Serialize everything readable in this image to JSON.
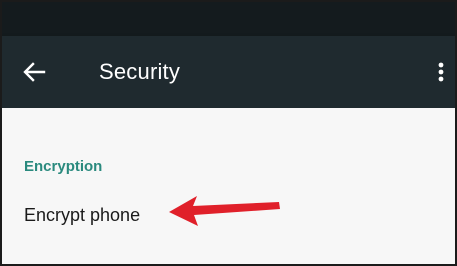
{
  "toolbar": {
    "title": "Security",
    "back_icon": "arrow-back-icon",
    "overflow_icon": "more-vert-icon"
  },
  "sections": [
    {
      "header": "Encryption",
      "items": [
        {
          "label": "Encrypt phone"
        }
      ]
    }
  ],
  "colors": {
    "status_bar": "#141b1e",
    "toolbar": "#1f2a2f",
    "section_header": "#2a8a7e",
    "annotation_arrow": "#e0202a"
  }
}
